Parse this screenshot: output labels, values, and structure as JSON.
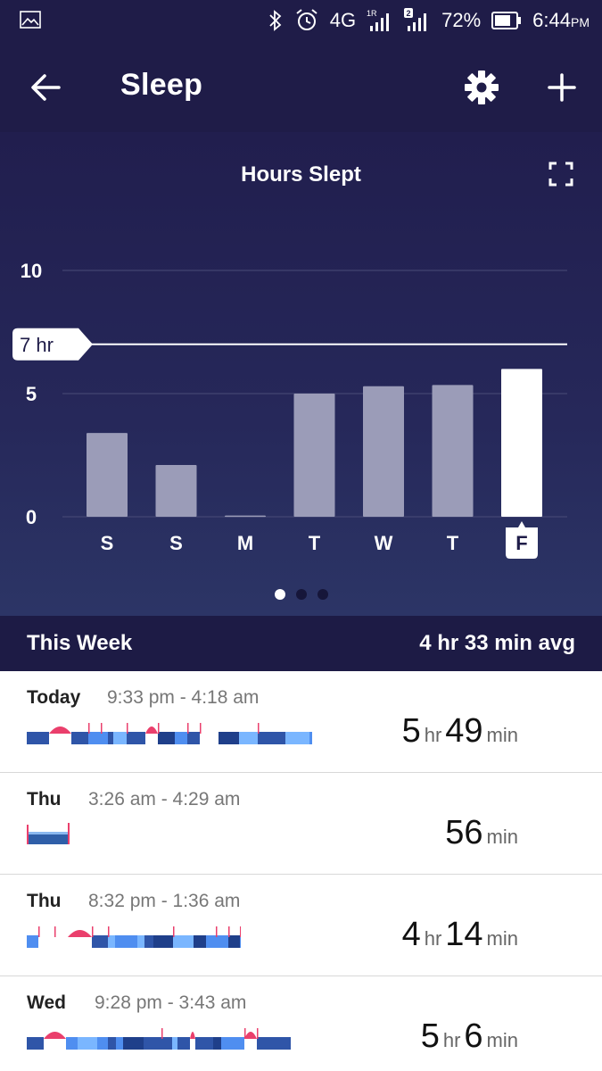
{
  "status_bar": {
    "network": "4G",
    "sim1_label": "1R",
    "sim2_label": "2",
    "battery": "72%",
    "time": "6:44",
    "time_suffix": "PM",
    "icons": [
      "image-icon",
      "bluetooth-icon",
      "alarm-icon",
      "signal-icon",
      "battery-icon"
    ]
  },
  "app_bar": {
    "title": "Sleep",
    "back_icon": "arrow-left-icon",
    "settings_icon": "gear-icon",
    "add_icon": "plus-icon"
  },
  "chart_data": {
    "type": "bar",
    "title": "Hours Slept",
    "categories": [
      "S",
      "S",
      "M",
      "T",
      "W",
      "T",
      "F"
    ],
    "values": [
      3.4,
      2.1,
      0.05,
      5.0,
      5.3,
      5.35,
      6.0
    ],
    "highlight_index": 6,
    "ylim": [
      0,
      10
    ],
    "yticks": [
      0,
      5,
      10
    ],
    "goal": {
      "value": 7,
      "label": "7 hr"
    },
    "grid": true,
    "colors": {
      "bar": "#9b9cb8",
      "highlight": "#ffffff",
      "grid": "#4a4c78"
    }
  },
  "pager": {
    "count": 3,
    "active": 0
  },
  "week_summary": {
    "label": "This Week",
    "average": "4 hr 33 min avg"
  },
  "entries": [
    {
      "day": "Today",
      "range": "9:33 pm - 4:18 am",
      "hours": "5",
      "hr_unit": "hr",
      "minutes": "49",
      "min_unit": "min"
    },
    {
      "day": "Thu",
      "range": "3:26 am - 4:29 am",
      "hours": "",
      "hr_unit": "",
      "minutes": "56",
      "min_unit": "min"
    },
    {
      "day": "Thu",
      "range": "8:32 pm - 1:36 am",
      "hours": "4",
      "hr_unit": "hr",
      "minutes": "14",
      "min_unit": "min"
    },
    {
      "day": "Wed",
      "range": "9:28 pm - 3:43 am",
      "hours": "5",
      "hr_unit": "hr",
      "minutes": "6",
      "min_unit": "min"
    }
  ]
}
